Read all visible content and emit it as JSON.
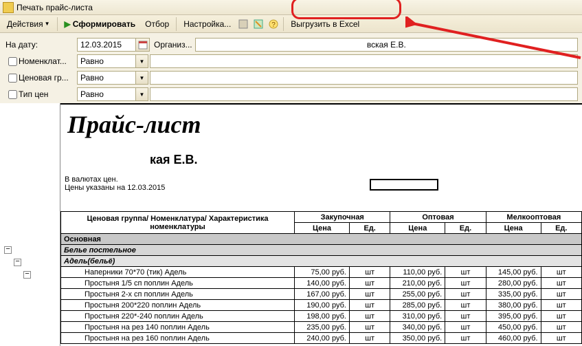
{
  "titlebar": {
    "title": "Печать прайс-листа"
  },
  "toolbar": {
    "actions": "Действия",
    "generate": "Сформировать",
    "filter": "Отбор",
    "settings": "Настройка...",
    "export_excel": "Выгрузить в Excel"
  },
  "filters": {
    "date_label": "На дату:",
    "date_value": "12.03.2015",
    "org_label": "Организ...",
    "org_value": "вская Е.В.",
    "nomenclature_label": "Номенклат...",
    "price_group_label": "Ценовая гр...",
    "price_type_label": "Тип цен",
    "equals": "Равно"
  },
  "report": {
    "title": "Прайс-лист",
    "subtitle": "кая Е.В.",
    "note1": "В валютах цен.",
    "note2": "Цены указаны на 12.03.2015",
    "headers": {
      "name": "Ценовая группа/ Номенклатура/ Характеристика номенклатуры",
      "col1": "Закупочная",
      "col2": "Оптовая",
      "col3": "Мелкооптовая",
      "price": "Цена",
      "unit": "Ед."
    },
    "group_main": "Основная",
    "subgroup_bed": "Белье постельное",
    "subsubgroup_adel": "Адель(бельё)",
    "unit": "шт",
    "rows": [
      {
        "name": "Наперники 70*70 (тик) Адель",
        "p1": "75,00 руб.",
        "p2": "110,00 руб.",
        "p3": "145,00 руб."
      },
      {
        "name": "Простыня 1/5 сп поплин Адель",
        "p1": "140,00 руб.",
        "p2": "210,00 руб.",
        "p3": "280,00 руб."
      },
      {
        "name": "Простыня 2-х сп поплин Адель",
        "p1": "167,00 руб.",
        "p2": "255,00 руб.",
        "p3": "335,00 руб."
      },
      {
        "name": "Простыня 200*220 поплин Адель",
        "p1": "190,00 руб.",
        "p2": "285,00 руб.",
        "p3": "380,00 руб."
      },
      {
        "name": "Простыня 220*-240 поплин Адель",
        "p1": "198,00 руб.",
        "p2": "310,00 руб.",
        "p3": "395,00 руб."
      },
      {
        "name": "Простыня на рез 140 поплин Адель",
        "p1": "235,00 руб.",
        "p2": "340,00 руб.",
        "p3": "450,00 руб."
      },
      {
        "name": "Простыня на рез 160 поплин Адель",
        "p1": "240,00 руб.",
        "p2": "350,00 руб.",
        "p3": "460,00 руб."
      }
    ]
  }
}
